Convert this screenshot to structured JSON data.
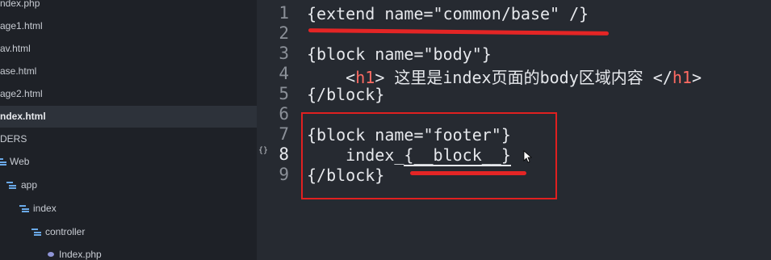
{
  "sidebar": {
    "items": [
      {
        "label": "ndex.php",
        "type": "file"
      },
      {
        "label": "age1.html",
        "type": "file"
      },
      {
        "label": "av.html",
        "type": "file"
      },
      {
        "label": "ase.html",
        "type": "file"
      },
      {
        "label": "age2.html",
        "type": "file"
      },
      {
        "label": "ndex.html",
        "type": "file",
        "active": true
      },
      {
        "label": "DERS",
        "type": "section"
      },
      {
        "label": "Web",
        "type": "folder"
      },
      {
        "label": "app",
        "type": "folder"
      },
      {
        "label": "index",
        "type": "folder"
      },
      {
        "label": "controller",
        "type": "folder"
      },
      {
        "label": "Index.php",
        "type": "file"
      }
    ]
  },
  "gutter": {
    "line_numbers": [
      "1",
      "2",
      "3",
      "4",
      "5",
      "6",
      "7",
      "8",
      "9"
    ],
    "fold_marker": "{}"
  },
  "code": {
    "line1": "{extend name=\"common/base\" /}",
    "line3": "{block name=\"body\"}",
    "line4_open": "<",
    "line4_tag": "h1",
    "line4_mid": "> 这里是index页面的body区域内容 </",
    "line4_tag2": "h1",
    "line4_close": ">",
    "line5": "{/block}",
    "line7": "{block name=\"footer\"}",
    "line8_prefix": "    index_",
    "line8_selected": "{__block__}",
    "line9": "{/block}"
  },
  "colors": {
    "background": "#262a31",
    "sidebar": "#1e2127",
    "tag": "#ff6b63",
    "annotation": "#e42525"
  }
}
